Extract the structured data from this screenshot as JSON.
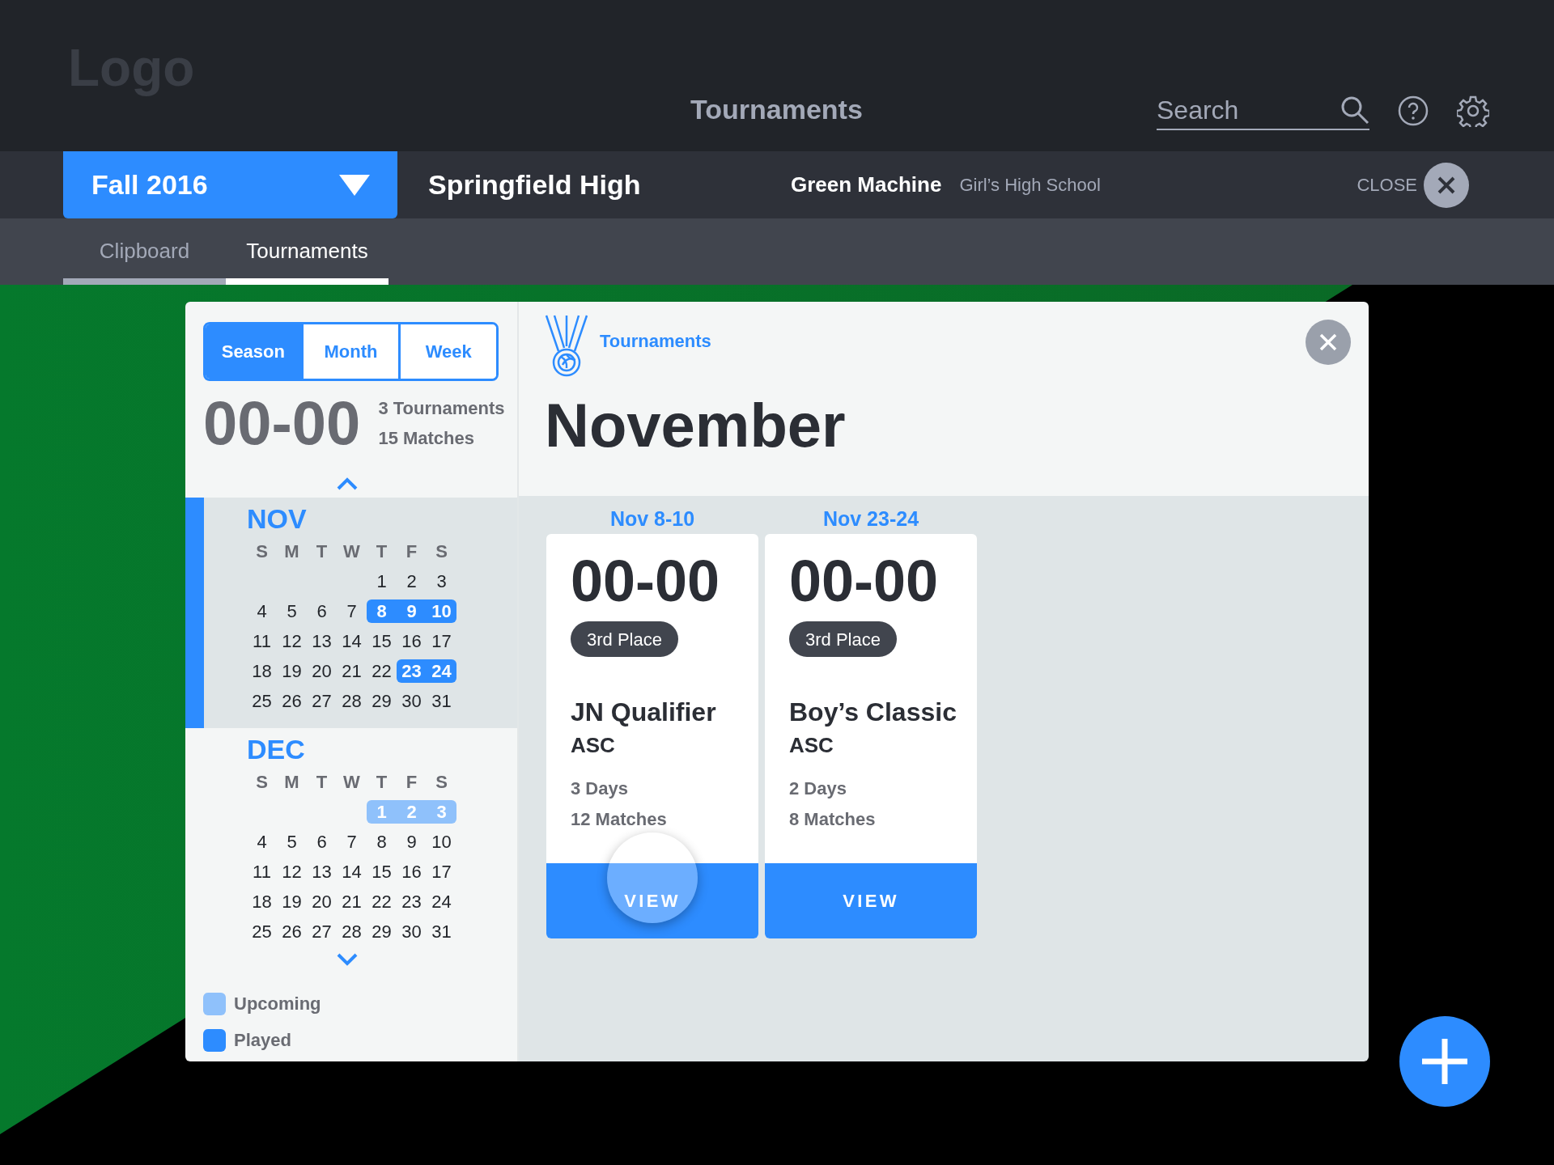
{
  "header": {
    "logo": "Logo",
    "title": "Tournaments",
    "search": {
      "placeholder": "Search"
    }
  },
  "team_bar": {
    "season": "Fall 2016",
    "school": "Springfield High",
    "team": "Green Machine",
    "team_type": "Girl’s High School",
    "close_label": "CLOSE"
  },
  "tabs": [
    {
      "label": "Clipboard",
      "selected": false
    },
    {
      "label": "Tournaments",
      "selected": true
    }
  ],
  "panel": {
    "views": [
      {
        "label": "Season",
        "selected": true
      },
      {
        "label": "Month",
        "selected": false
      },
      {
        "label": "Week",
        "selected": false
      }
    ],
    "record": "00-00",
    "stats": [
      "3 Tournaments",
      "15 Matches"
    ],
    "months": [
      {
        "name": "NOV",
        "selected": true,
        "weekdays": [
          "S",
          "M",
          "T",
          "W",
          "T",
          "F",
          "S"
        ],
        "weeks": [
          [
            {
              "day": "1",
              "kind": "plain"
            },
            {
              "day": "2",
              "kind": "plain"
            },
            {
              "day": "3",
              "kind": "plain"
            }
          ],
          [
            {
              "day": "4",
              "kind": "plain"
            },
            {
              "day": "5",
              "kind": "plain"
            },
            {
              "day": "6",
              "kind": "plain"
            },
            {
              "day": "7",
              "kind": "plain"
            },
            {
              "day": "8",
              "kind": "played"
            },
            {
              "day": "9",
              "kind": "played"
            },
            {
              "day": "10",
              "kind": "played"
            }
          ],
          [
            {
              "day": "11",
              "kind": "plain"
            },
            {
              "day": "12",
              "kind": "plain"
            },
            {
              "day": "13",
              "kind": "plain"
            },
            {
              "day": "14",
              "kind": "plain"
            },
            {
              "day": "15",
              "kind": "plain"
            },
            {
              "day": "16",
              "kind": "plain"
            },
            {
              "day": "17",
              "kind": "plain"
            }
          ],
          [
            {
              "day": "18",
              "kind": "plain"
            },
            {
              "day": "19",
              "kind": "plain"
            },
            {
              "day": "20",
              "kind": "plain"
            },
            {
              "day": "21",
              "kind": "plain"
            },
            {
              "day": "22",
              "kind": "plain"
            },
            {
              "day": "23",
              "kind": "played"
            },
            {
              "day": "24",
              "kind": "played"
            }
          ],
          [
            {
              "day": "25",
              "kind": "plain"
            },
            {
              "day": "26",
              "kind": "plain"
            },
            {
              "day": "27",
              "kind": "plain"
            },
            {
              "day": "28",
              "kind": "plain"
            },
            {
              "day": "29",
              "kind": "plain"
            },
            {
              "day": "30",
              "kind": "plain"
            },
            {
              "day": "31",
              "kind": "plain"
            }
          ]
        ]
      },
      {
        "name": "DEC",
        "selected": false,
        "weekdays": [
          "S",
          "M",
          "T",
          "W",
          "T",
          "F",
          "S"
        ],
        "weeks": [
          [
            {
              "day": "1",
              "kind": "upcoming"
            },
            {
              "day": "2",
              "kind": "upcoming"
            },
            {
              "day": "3",
              "kind": "upcoming"
            }
          ],
          [
            {
              "day": "4",
              "kind": "plain"
            },
            {
              "day": "5",
              "kind": "plain"
            },
            {
              "day": "6",
              "kind": "plain"
            },
            {
              "day": "7",
              "kind": "plain"
            },
            {
              "day": "8",
              "kind": "plain"
            },
            {
              "day": "9",
              "kind": "plain"
            },
            {
              "day": "10",
              "kind": "plain"
            }
          ],
          [
            {
              "day": "11",
              "kind": "plain"
            },
            {
              "day": "12",
              "kind": "plain"
            },
            {
              "day": "13",
              "kind": "plain"
            },
            {
              "day": "14",
              "kind": "plain"
            },
            {
              "day": "15",
              "kind": "plain"
            },
            {
              "day": "16",
              "kind": "plain"
            },
            {
              "day": "17",
              "kind": "plain"
            }
          ],
          [
            {
              "day": "18",
              "kind": "plain"
            },
            {
              "day": "19",
              "kind": "plain"
            },
            {
              "day": "20",
              "kind": "plain"
            },
            {
              "day": "21",
              "kind": "plain"
            },
            {
              "day": "22",
              "kind": "plain"
            },
            {
              "day": "23",
              "kind": "plain"
            },
            {
              "day": "24",
              "kind": "plain"
            }
          ],
          [
            {
              "day": "25",
              "kind": "plain"
            },
            {
              "day": "26",
              "kind": "plain"
            },
            {
              "day": "27",
              "kind": "plain"
            },
            {
              "day": "28",
              "kind": "plain"
            },
            {
              "day": "29",
              "kind": "plain"
            },
            {
              "day": "30",
              "kind": "plain"
            },
            {
              "day": "31",
              "kind": "plain"
            }
          ]
        ]
      }
    ],
    "legend": [
      {
        "kind": "upcoming",
        "label": "Upcoming",
        "color": "#8fc1fb"
      },
      {
        "kind": "played",
        "label": "Played",
        "color": "#2d8cff"
      }
    ]
  },
  "detail": {
    "section": "Tournaments",
    "title": "November",
    "cards": [
      {
        "date": "Nov 8-10",
        "score": "00-00",
        "place": "3rd Place",
        "name": "JN Qualifier",
        "org": "ASC",
        "days": "3 Days",
        "matches": "12 Matches",
        "button": "VIEW",
        "pressed": true
      },
      {
        "date": "Nov 23-24",
        "score": "00-00",
        "place": "3rd Place",
        "name": "Boy’s Classic",
        "org": "ASC",
        "days": "2 Days",
        "matches": "8 Matches",
        "button": "VIEW",
        "pressed": false
      }
    ]
  }
}
